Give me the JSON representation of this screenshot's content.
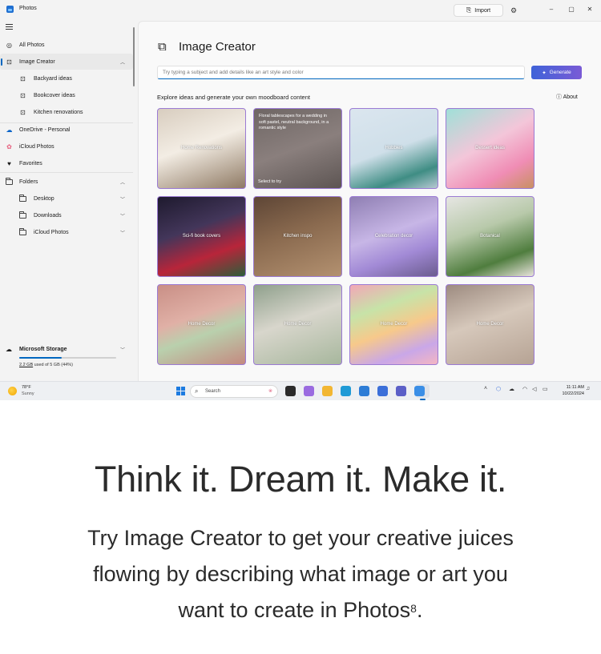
{
  "window": {
    "title": "Photos",
    "import_label": "Import",
    "controls": [
      "–",
      "▢",
      "✕"
    ]
  },
  "sidebar": {
    "items": [
      {
        "label": "All Photos",
        "icon": "photos-icon"
      },
      {
        "label": "Image Creator",
        "icon": "image-creator-icon",
        "active": true
      },
      {
        "label": "Backyard ideas",
        "icon": "image-icon"
      },
      {
        "label": "Bookcover ideas",
        "icon": "image-icon"
      },
      {
        "label": "Kitchen renovations",
        "icon": "image-icon"
      },
      {
        "label": "OneDrive - Personal",
        "icon": "onedrive-icon"
      },
      {
        "label": "iCloud Photos",
        "icon": "icloud-icon"
      },
      {
        "label": "Favorites",
        "icon": "heart-icon"
      },
      {
        "label": "Folders",
        "icon": "folder-icon"
      },
      {
        "label": "Desktop",
        "icon": "folder-icon"
      },
      {
        "label": "Downloads",
        "icon": "folder-icon"
      },
      {
        "label": "iCloud Photos",
        "icon": "folder-icon"
      }
    ],
    "storage": {
      "title": "Microsoft Storage",
      "used": "2.2 GB",
      "rest": " used of 5 GB (44%)",
      "fraction": 0.44
    }
  },
  "main": {
    "title": "Image Creator",
    "prompt_placeholder": "Try typing a subject and add details like an art style and color",
    "generate_label": "Generate",
    "explore_label": "Explore ideas and generate your own moodboard content",
    "about_label": "About",
    "tiles": [
      {
        "label": "Home Renovations",
        "bg": "linear-gradient(160deg,#d8cdbf 0%,#f3ede4 45%,#8f7a64 100%)"
      },
      {
        "label": "",
        "caption": "Floral tablescapes for a wedding in soft pastel, neutral background, in a romantic style",
        "try": "Select to try",
        "bg": "linear-gradient(160deg,#6e6664 0%,#8a7f7d 50%,#5d5553 100%)"
      },
      {
        "label": "Hobbies",
        "bg": "linear-gradient(160deg,#dbe6ef 0%,#cfdfe9 50%,#3f8d84 80%,#b7c9d3 100%)"
      },
      {
        "label": "Dessert ideas",
        "bg": "linear-gradient(150deg,#9fe0d8 0%,#f3c6d9 45%,#f08db5 75%,#c89062 100%)"
      },
      {
        "label": "Sci-fi book covers",
        "bg": "linear-gradient(160deg,#1e1a2e 0%,#43365a 40%,#b8253a 70%,#2c5e3a 100%)"
      },
      {
        "label": "Kitchen inspo",
        "bg": "linear-gradient(160deg,#5e4636 0%,#8a6a4f 45%,#b39170 100%)"
      },
      {
        "label": "Celebration decor",
        "bg": "linear-gradient(160deg,#8f7fb3 0%,#c7b6e6 45%,#a28ad6 70%,#6b5c8f 100%)"
      },
      {
        "label": "Botanical",
        "bg": "linear-gradient(160deg,#e6e6e3 0%,#b8c9aa 40%,#4f7d3e 75%,#e8e3dc 100%)"
      },
      {
        "label": "Home Decor",
        "bg": "linear-gradient(160deg,#c98f86 0%,#e0b0a6 40%,#b9d0ad 60%,#c48a80 100%)"
      },
      {
        "label": "Home Decor",
        "bg": "linear-gradient(160deg,#8fa08c 0%,#d8d6cc 45%,#a7b79d 100%)"
      },
      {
        "label": "Home Decor",
        "bg": "linear-gradient(160deg,#f2a7b7 0%,#c7e3a8 30%,#f7c98b 55%,#c9a7e8 80%,#f4b6c2 100%)"
      },
      {
        "label": "Home Decor",
        "bg": "linear-gradient(160deg,#9d8b80 0%,#d6c8bb 45%,#b6a394 100%)"
      }
    ]
  },
  "taskbar": {
    "temperature": "78°F",
    "condition": "Sunny",
    "search_placeholder": "Search",
    "time": "11:11 AM",
    "date": "10/22/2024",
    "apps": [
      {
        "name": "terminal-icon",
        "color": "#2b2b2b"
      },
      {
        "name": "copilot-icon",
        "color": "#9a6be0"
      },
      {
        "name": "file-explorer-icon",
        "color": "#f2b632"
      },
      {
        "name": "edge-icon",
        "color": "#1f9ad6"
      },
      {
        "name": "store-icon",
        "color": "#2d7cd6"
      },
      {
        "name": "todo-icon",
        "color": "#3b6fd9"
      },
      {
        "name": "teams-icon",
        "color": "#5b5fc7"
      },
      {
        "name": "photos-app-icon",
        "color": "#3a8ee6"
      }
    ]
  },
  "marketing": {
    "headline": "Think it. Dream it. Make it.",
    "body": "Try Image Creator to get your creative juices flowing by describing what image or art you want to create in Photos",
    "footnote": "8",
    "end": "."
  }
}
